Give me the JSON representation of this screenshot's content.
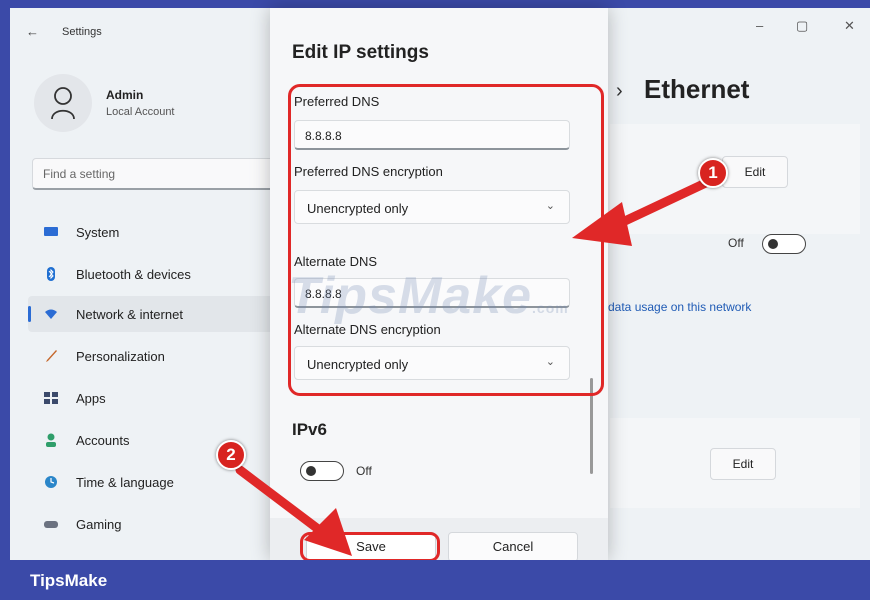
{
  "window": {
    "title": "Settings",
    "back_glyph": "←",
    "controls": [
      "–",
      "▢",
      "✕"
    ]
  },
  "user": {
    "name": "Admin",
    "account_type": "Local Account"
  },
  "search": {
    "placeholder": "Find a setting"
  },
  "sidebar": {
    "items": [
      {
        "label": "System",
        "icon": "monitor-icon",
        "color": "#2b6cd4"
      },
      {
        "label": "Bluetooth & devices",
        "icon": "bluetooth-icon",
        "color": "#1f6fd1"
      },
      {
        "label": "Network & internet",
        "icon": "wifi-icon",
        "color": "#2b6cd4",
        "active": true
      },
      {
        "label": "Personalization",
        "icon": "brush-icon",
        "color": "#c5672b"
      },
      {
        "label": "Apps",
        "icon": "apps-icon",
        "color": "#3b4a6b"
      },
      {
        "label": "Accounts",
        "icon": "person-icon",
        "color": "#2f9e6a"
      },
      {
        "label": "Time & language",
        "icon": "globe-clock-icon",
        "color": "#2a86c9"
      },
      {
        "label": "Gaming",
        "icon": "gamepad-icon",
        "color": "#6b7280"
      }
    ]
  },
  "content": {
    "breadcrumb_chevron": "›",
    "title": "Ethernet",
    "edit_label": "Edit",
    "metered_state": "Off",
    "data_usage_link": "data usage on this network",
    "edit_label_2": "Edit"
  },
  "dialog": {
    "title": "Edit IP settings",
    "preferred_dns_label": "Preferred DNS",
    "preferred_dns_value": "8.8.8.8",
    "preferred_enc_label": "Preferred DNS encryption",
    "preferred_enc_value": "Unencrypted only",
    "alternate_dns_label": "Alternate DNS",
    "alternate_dns_value": "8.8.8.8",
    "alternate_enc_label": "Alternate DNS encryption",
    "alternate_enc_value": "Unencrypted only",
    "ipv6_label": "IPv6",
    "ipv6_state": "Off",
    "save_label": "Save",
    "cancel_label": "Cancel",
    "chevron": "⌄"
  },
  "annotations": {
    "step1": "1",
    "step2": "2",
    "accent": "#e02828"
  },
  "watermark": {
    "text": "TipsMake",
    "suffix": ".com"
  },
  "footer_brand": "TipsMake"
}
